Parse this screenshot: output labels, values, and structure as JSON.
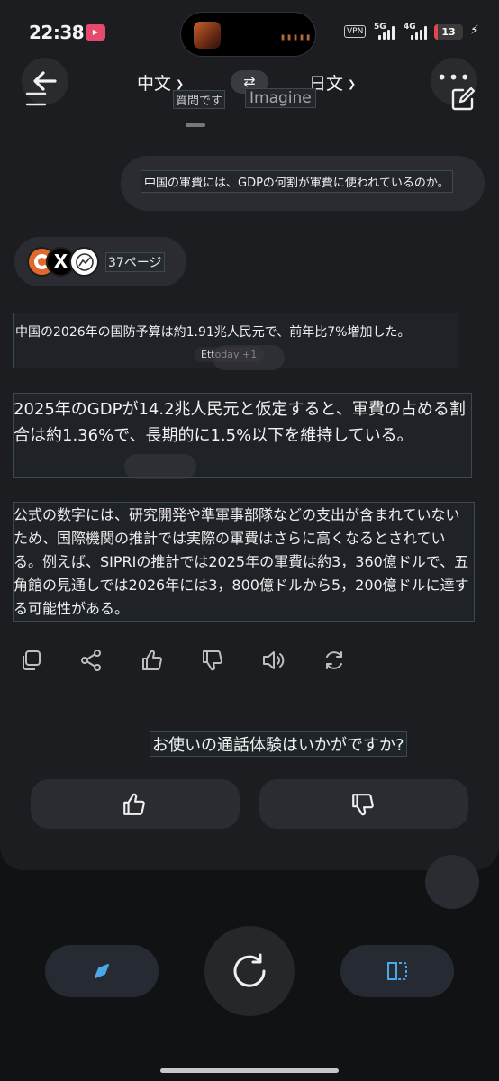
{
  "status": {
    "time": "22:38",
    "vpn": "VPN",
    "network_1": "5G",
    "network_2": "4G",
    "battery": "13",
    "battery_level_percent": 13
  },
  "header": {
    "source_lang": "中文",
    "target_lang": "日文",
    "swap_symbol": "⇄",
    "sub_label_left": "質問です",
    "sub_label_right": "Imagine",
    "more_symbol": "•••"
  },
  "conversation": {
    "user_message": "中国の軍費には、GDPの何割が軍費に使われているのか。",
    "sources": {
      "x_glyph": "X",
      "pages_label": "37ページ"
    },
    "answer_para1": "中国の2026年の国防予算は約1.91兆人民元で、前年比7%増加した。",
    "citation": "Ettoday +1",
    "answer_para2": "2025年のGDPが14.2兆人民元と仮定すると、軍費の占める割合は約1.36%で、長期的に1.5%以下を維持している。",
    "answer_para3": "公式の数字には、研究開発や準軍事部隊などの支出が含まれていないため、国際機関の推計では実際の軍費はさらに高くなるとされている。例えば、SIPRIの推計では2025年の軍費は約3，360億ドルで、五角館の見通しでは2026年には3，800億ドルから5，200億ドルに達する可能性がある。"
  },
  "feedback": {
    "question": "お使いの通話体験はいかがですか?"
  },
  "colors": {
    "background": "#111214",
    "card": "#1c1d20",
    "bubble": "#2b2c31",
    "accent_blue": "#4aa8ea"
  }
}
